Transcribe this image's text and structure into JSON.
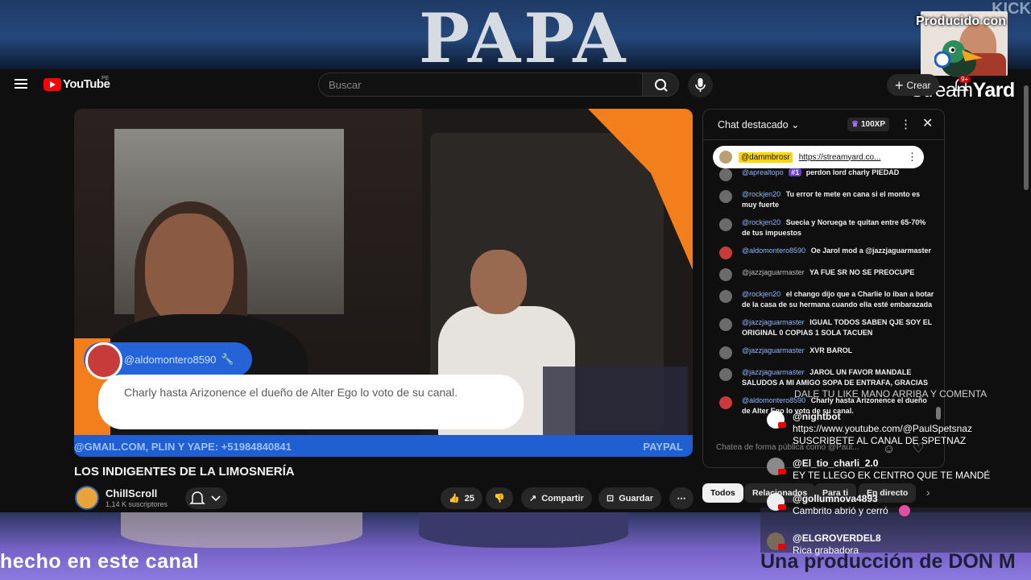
{
  "overlay": {
    "banner_text": "PAPA",
    "banner_corner": "KICK",
    "produced_by": "Producido con",
    "streamyard_light": "Stream",
    "streamyard_bold": "Yard",
    "bottom_left_text": "hecho en este canal",
    "bottom_right_text": "Una producción de DON M"
  },
  "header": {
    "logo_text": "YouTube",
    "region": "PE",
    "search_placeholder": "Buscar",
    "create_label": "Crear",
    "notifications_badge": "9+"
  },
  "video": {
    "overlay_username": "@aldomontero8590",
    "overlay_message": "Charly hasta Arizonence el dueño de Alter Ego lo voto de su canal.",
    "ticker": "@GMAIL.COM, PLIN Y YAPE: +51984840841",
    "ticker_right": "PAYPAL",
    "title": "LOS INDIGENTES DE LA LIMOSNERÍA",
    "channel_name": "ChillScroll",
    "subscribers": "1,14 K suscriptores",
    "likes": "25",
    "share_label": "Compartir",
    "save_label": "Guardar"
  },
  "chat": {
    "title": "Chat destacado",
    "xp": "100XP",
    "pinned_user": "@dammbrosr",
    "pinned_link": "https://streamyard.co...",
    "messages": [
      {
        "author": "@aprealtopo",
        "badge": "#1",
        "text": "perdon lord charly PIEDAD"
      },
      {
        "author": "@rockjen20",
        "text": "Tu error te mete en cana si el monto es muy fuerte"
      },
      {
        "author": "@rockjen20",
        "text": "Suecia y Noruega te quitan entre 65-70% de tus impuestos"
      },
      {
        "author": "@aldomontero8590",
        "text": "Oe Jarol mod a @jazzjaguarmaster"
      },
      {
        "author": "@jazzjaguarmaster",
        "text": "YA FUE SR NO SE PREOCUPE"
      },
      {
        "author": "@rockjen20",
        "text": "el chango dijo que a Charlie lo iban a botar de la casa de su hermana cuando ella esté embarazada"
      },
      {
        "author": "@jazzjaguarmaster",
        "text": "IGUAL TODOS SABEN QJE SOY EL ORIGINAL 0 COPIAS 1 SOLA TACUEN"
      },
      {
        "author": "@jazzjaguarmaster",
        "text": "XVR BAROL"
      },
      {
        "author": "@jazzjaguarmaster",
        "text": "JAROL UN FAVOR MANDALE SALUDOS A MI AMIGO SOPA DE ENTRAFA, GRACIAS"
      },
      {
        "author": "@aldomontero8590",
        "text": "Charly hasta Arizonence el dueño de Alter Ego lo voto de su canal."
      }
    ],
    "input_placeholder": "Chatea de forma pública como @Paul..."
  },
  "chips": [
    "Todos",
    "Relacionados",
    "Para ti",
    "En directo"
  ],
  "overlay_comments": {
    "top_line": "DALE TU LIKE MANO ARRIBA Y COMENTA",
    "items": [
      {
        "name": "@nightbot",
        "text": "https://www.youtube.com/@PaulSpetsnaz",
        "text2": "SUSCRIBETE AL CANAL DE SPETNAZ"
      },
      {
        "name": "@El_tio_charli_2.0",
        "text": "EY TE LLEGO EK CENTRO QUE TE MANDÉ"
      },
      {
        "name": "@gollumnova4893",
        "text": "Cambrito abrió y cerró"
      },
      {
        "name": "@ELGROVERDEL8",
        "text": "Rica grabadora"
      }
    ]
  }
}
